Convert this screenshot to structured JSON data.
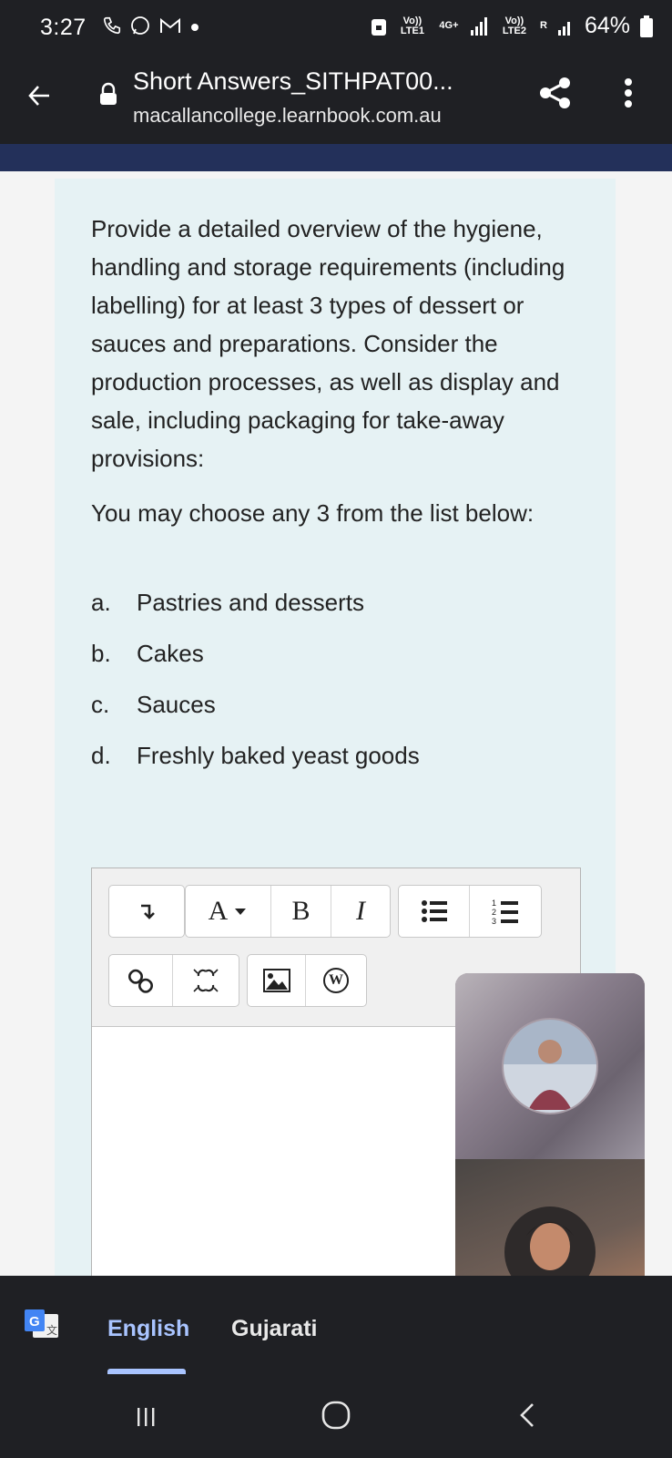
{
  "status": {
    "time": "3:27",
    "battery": "64%",
    "net_volte1": "Vo)) LTE1",
    "net_4g": "4G+",
    "net_volte2": "Vo)) LTE2",
    "roaming": "R"
  },
  "browser": {
    "title": "Short Answers_SITHPAT00...",
    "url": "macallancollege.learnbook.com.au"
  },
  "question": {
    "prompt": "Provide a detailed overview of the hygiene, handling and storage requirements (including labelling) for at least 3 types of dessert or sauces and preparations. Consider the production processes, as well as display and sale, including packaging for take-away provisions:",
    "choose": "You may choose any 3 from the list below:",
    "options": [
      {
        "letter": "a.",
        "label": "Pastries and desserts"
      },
      {
        "letter": "b.",
        "label": "Cakes"
      },
      {
        "letter": "c.",
        "label": "Sauces"
      },
      {
        "letter": "d.",
        "label": "Freshly baked yeast goods"
      }
    ]
  },
  "editor": {
    "font_button": "A",
    "bold_button": "B",
    "italic_button": "I",
    "word_button": "W"
  },
  "translate": {
    "source_lang": "English",
    "target_lang": "Gujarati"
  },
  "colors": {
    "system_bar": "#1f2024",
    "navy_strip": "#23305a",
    "card_bg": "#e6f2f4",
    "translate_accent": "#a9c4ff"
  }
}
